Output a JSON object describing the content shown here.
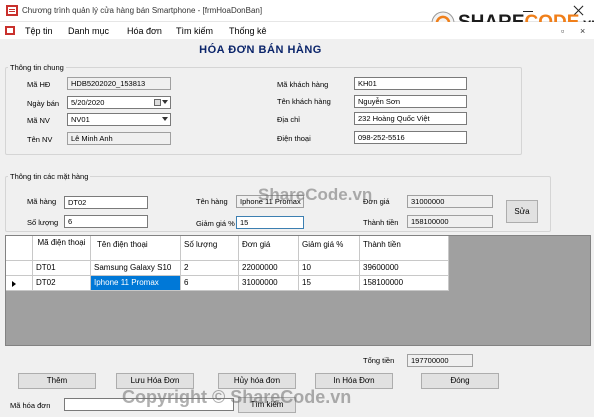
{
  "window": {
    "title": "Chương trình quản lý cửa hàng bán Smartphone - [frmHoaDonBan]"
  },
  "menu": {
    "items": [
      "Tệp tin",
      "Danh mục",
      "Hóa đơn",
      "Tìm kiếm",
      "Thống kê"
    ],
    "mdi_restore": "▫",
    "mdi_close": "×"
  },
  "form_title": "HÓA ĐƠN BÁN HÀNG",
  "general": {
    "group_title": "Thông tin chung",
    "ma_hd_label": "Mã HĐ",
    "ma_hd_value": "HDB5202020_153813",
    "ngay_ban_label": "Ngày bán",
    "ngay_ban_value": "5/20/2020",
    "ma_nv_label": "Mã NV",
    "ma_nv_value": "NV01",
    "ten_nv_label": "Tên NV",
    "ten_nv_value": "Lê Minh Anh",
    "ma_kh_label": "Mã khách hàng",
    "ma_kh_value": "KH01",
    "ten_kh_label": "Tên khách hàng",
    "ten_kh_value": "Nguyễn Sơn",
    "dia_chi_label": "Địa chỉ",
    "dia_chi_value": "232 Hoàng Quốc Việt",
    "dien_thoai_label": "Điện thoại",
    "dien_thoai_value": "098-252-5516"
  },
  "items": {
    "group_title": "Thông tin các mặt hàng",
    "ma_hang_label": "Mã hàng",
    "ma_hang_value": "DT02",
    "so_luong_label": "Số lượng",
    "so_luong_value": "6",
    "ten_hang_label": "Tên hàng",
    "ten_hang_value": "Iphone 11 Promax",
    "giam_gia_label": "Giảm giá %",
    "giam_gia_value": "15",
    "don_gia_label": "Đơn giá",
    "don_gia_value": "31000000",
    "thanh_tien_label": "Thành tiền",
    "thanh_tien_value": "158100000",
    "sua_button": "Sửa"
  },
  "grid": {
    "headers": [
      "Mã điện thoại",
      "Tên điện thoại",
      "Số lượng",
      "Đơn giá",
      "Giảm giá %",
      "Thành tiền"
    ],
    "rows": [
      [
        "DT01",
        "Samsung Galaxy S10",
        "2",
        "22000000",
        "10",
        "39600000"
      ],
      [
        "DT02",
        "Iphone 11 Promax",
        "6",
        "31000000",
        "15",
        "158100000"
      ]
    ]
  },
  "total": {
    "label": "Tổng tiền",
    "value": "197700000"
  },
  "buttons": {
    "them": "Thêm",
    "luu": "Lưu Hóa Đơn",
    "huy": "Hủy hóa đơn",
    "in": "In Hóa Đơn",
    "dong": "Đóng",
    "tim_kiem": "Tìm kiếm"
  },
  "search": {
    "ma_hd_label": "Mã hóa đơn",
    "ma_hd_value": ""
  },
  "watermark": {
    "logo_share": "SHARE",
    "logo_code": "CODE",
    "logo_vn": ".vn",
    "mid": "ShareCode.vn",
    "bottom": "Copyright © ShareCode.vn"
  },
  "colors": {
    "selection": "#0078d7",
    "title_text": "#0a246a",
    "logo_orange": "#f07f1a"
  }
}
